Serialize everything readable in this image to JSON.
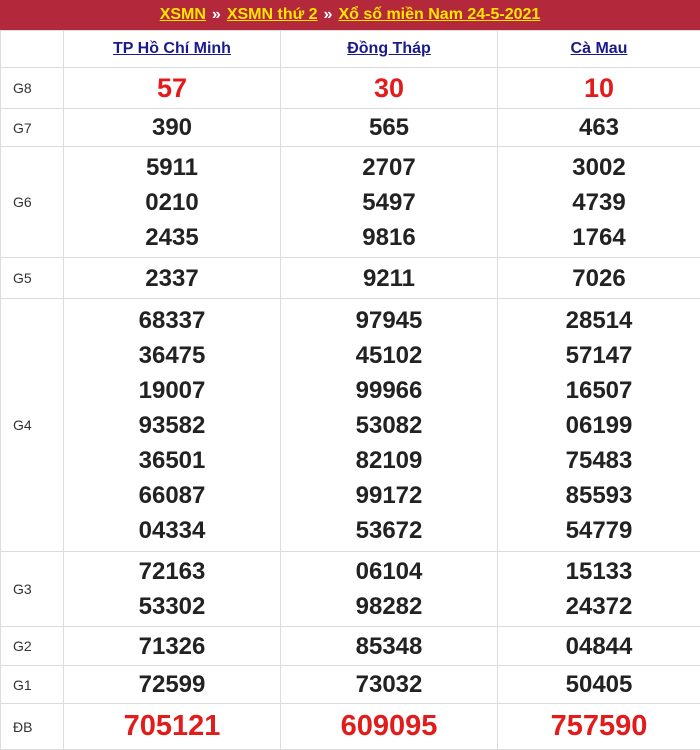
{
  "breadcrumb": {
    "xsmn": "XSMN",
    "sep": "»",
    "xsmn_thu2": "XSMN thứ 2",
    "page": "Xổ số miền Nam 24-5-2021"
  },
  "columns": [
    "TP Hồ Chí Minh",
    "Đồng Tháp",
    "Cà Mau"
  ],
  "rows": [
    {
      "label": "G8",
      "cells": [
        [
          "57"
        ],
        [
          "30"
        ],
        [
          "10"
        ]
      ]
    },
    {
      "label": "G7",
      "cells": [
        [
          "390"
        ],
        [
          "565"
        ],
        [
          "463"
        ]
      ]
    },
    {
      "label": "G6",
      "cells": [
        [
          "5911",
          "0210",
          "2435"
        ],
        [
          "2707",
          "5497",
          "9816"
        ],
        [
          "3002",
          "4739",
          "1764"
        ]
      ]
    },
    {
      "label": "G5",
      "cells": [
        [
          "2337"
        ],
        [
          "9211"
        ],
        [
          "7026"
        ]
      ]
    },
    {
      "label": "G4",
      "cells": [
        [
          "68337",
          "36475",
          "19007",
          "93582",
          "36501",
          "66087",
          "04334"
        ],
        [
          "97945",
          "45102",
          "99966",
          "53082",
          "82109",
          "99172",
          "53672"
        ],
        [
          "28514",
          "57147",
          "16507",
          "06199",
          "75483",
          "85593",
          "54779"
        ]
      ]
    },
    {
      "label": "G3",
      "cells": [
        [
          "72163",
          "53302"
        ],
        [
          "06104",
          "98282"
        ],
        [
          "15133",
          "24372"
        ]
      ]
    },
    {
      "label": "G2",
      "cells": [
        [
          "71326"
        ],
        [
          "85348"
        ],
        [
          "04844"
        ]
      ]
    },
    {
      "label": "G1",
      "cells": [
        [
          "72599"
        ],
        [
          "73032"
        ],
        [
          "50405"
        ]
      ]
    },
    {
      "label": "ĐB",
      "cells": [
        [
          "705121"
        ],
        [
          "609095"
        ],
        [
          "757590"
        ]
      ]
    }
  ],
  "colors": {
    "header_bg": "#b4283c",
    "header_text": "#ffe600",
    "highlight_number": "#e21b1b",
    "link": "#1a1a8c"
  }
}
